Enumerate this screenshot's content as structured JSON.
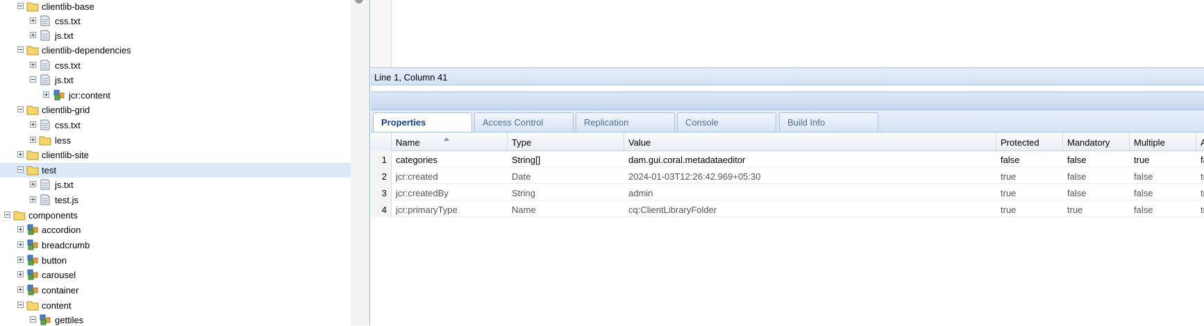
{
  "tree": {
    "items": [
      {
        "label": "clientlib-base",
        "icon": "folder-icon",
        "toggle": "minus"
      },
      {
        "label": "css.txt",
        "icon": "file-icon",
        "toggle": "plus"
      },
      {
        "label": "js.txt",
        "icon": "file-icon",
        "toggle": "plus"
      },
      {
        "label": "clientlib-dependencies",
        "icon": "folder-icon",
        "toggle": "minus"
      },
      {
        "label": "css.txt",
        "icon": "file-icon",
        "toggle": "plus"
      },
      {
        "label": "js.txt",
        "icon": "file-icon",
        "toggle": "minus"
      },
      {
        "label": "jcr:content",
        "icon": "node-icon",
        "toggle": "plus"
      },
      {
        "label": "clientlib-grid",
        "icon": "folder-icon",
        "toggle": "minus"
      },
      {
        "label": "css.txt",
        "icon": "file-icon",
        "toggle": "plus"
      },
      {
        "label": "less",
        "icon": "folder-icon",
        "toggle": "plus"
      },
      {
        "label": "clientlib-site",
        "icon": "folder-icon",
        "toggle": "plus"
      },
      {
        "label": "test",
        "icon": "folder-icon",
        "toggle": "minus",
        "selected": true
      },
      {
        "label": "js.txt",
        "icon": "file-icon",
        "toggle": "plus"
      },
      {
        "label": "test.js",
        "icon": "file-icon",
        "toggle": "plus"
      },
      {
        "label": "components",
        "icon": "folder-icon",
        "toggle": "minus"
      },
      {
        "label": "accordion",
        "icon": "component-icon",
        "toggle": "plus"
      },
      {
        "label": "breadcrumb",
        "icon": "component-icon",
        "toggle": "plus"
      },
      {
        "label": "button",
        "icon": "component-icon",
        "toggle": "plus"
      },
      {
        "label": "carousel",
        "icon": "component-icon",
        "toggle": "plus"
      },
      {
        "label": "container",
        "icon": "component-icon",
        "toggle": "plus"
      },
      {
        "label": "content",
        "icon": "folder-icon",
        "toggle": "minus"
      },
      {
        "label": "gettiles",
        "icon": "component-icon",
        "toggle": "minus"
      }
    ]
  },
  "editor": {
    "status": "Line 1, Column 41"
  },
  "tabs": [
    {
      "label": "Properties",
      "active": true
    },
    {
      "label": "Access Control",
      "active": false
    },
    {
      "label": "Replication",
      "active": false
    },
    {
      "label": "Console",
      "active": false
    },
    {
      "label": "Build Info",
      "active": false
    }
  ],
  "grid": {
    "columns": [
      "Name",
      "Type",
      "Value",
      "Protected",
      "Mandatory",
      "Multiple",
      "A"
    ],
    "rows": [
      {
        "num": "1",
        "name": "categories",
        "type": "String[]",
        "value": "dam.gui.coral.metadataeditor",
        "protected": "false",
        "mandatory": "false",
        "multiple": "true",
        "a": "fa"
      },
      {
        "num": "2",
        "name": "jcr:created",
        "type": "Date",
        "value": "2024-01-03T12:26:42.969+05:30",
        "protected": "true",
        "mandatory": "false",
        "multiple": "false",
        "a": "tr"
      },
      {
        "num": "3",
        "name": "jcr:createdBy",
        "type": "String",
        "value": "admin",
        "protected": "true",
        "mandatory": "false",
        "multiple": "false",
        "a": "tr"
      },
      {
        "num": "4",
        "name": "jcr:primaryType",
        "type": "Name",
        "value": "cq:ClientLibraryFolder",
        "protected": "true",
        "mandatory": "true",
        "multiple": "false",
        "a": "tr"
      }
    ]
  }
}
